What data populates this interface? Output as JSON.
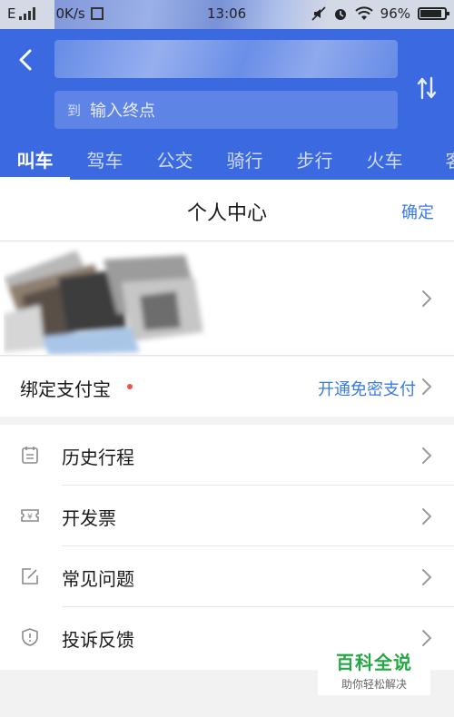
{
  "status_bar": {
    "network": "E",
    "speed": "0K/s",
    "time": "13:06",
    "battery": "96%",
    "battery_level": 0.96
  },
  "header": {
    "end_field": {
      "prefix": "到",
      "placeholder": "输入终点"
    },
    "tabs": [
      "叫车",
      "驾车",
      "公交",
      "骑行",
      "步行",
      "火车",
      "客"
    ],
    "active_tab": "叫车",
    "color": "#3b6ae0"
  },
  "page": {
    "title": "个人中心",
    "confirm": "确定"
  },
  "alipay": {
    "label": "绑定支付宝",
    "action": "开通免密支付"
  },
  "menu": [
    {
      "label": "历史行程",
      "icon": "calendar-icon"
    },
    {
      "label": "开发票",
      "icon": "invoice-icon"
    },
    {
      "label": "常见问题",
      "icon": "edit-icon"
    },
    {
      "label": "投诉反馈",
      "icon": "shield-icon"
    }
  ],
  "watermark": {
    "title": "百科全说",
    "subtitle": "助你轻松解决"
  },
  "colors": {
    "accent": "#3b7be6",
    "header_blue": "#3b6ae0",
    "dot_red": "#f0504a"
  }
}
